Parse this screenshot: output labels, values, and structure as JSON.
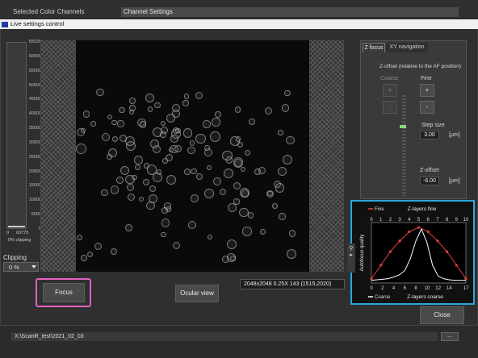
{
  "background_app": {
    "left_label": "Selected Color Channels",
    "channel_settings_label": "Channel Settings",
    "path_value": "X:\\ScanR_test\\2021_02_03",
    "path_button": "..."
  },
  "window": {
    "title": "Live settings control"
  },
  "histogram": {
    "scale_ticks": [
      "65535",
      "60000",
      "55000",
      "50000",
      "45000",
      "40000",
      "35000",
      "30000",
      "25000",
      "20000",
      "15000",
      "10000",
      "5000",
      "0"
    ],
    "range_min": "0",
    "range_max": "63775",
    "clipping_pct_text": "0% clipping",
    "clipping_label": "Clipping",
    "clipping_value": "0 %"
  },
  "image_info": "2048x2048 0.25X 143   (1515,2020)",
  "buttons": {
    "focus": "Focus",
    "ocular_view": "Ocular view",
    "close": "Close"
  },
  "tabs": [
    {
      "label": "Z focus",
      "active": true
    },
    {
      "label": "XY navigation",
      "active": false
    }
  ],
  "z_focus": {
    "z_offset_caption": "Z-offset (relative to the AF position)",
    "coarse_label": "Coarse",
    "fine_label": "Fine",
    "plus": "+",
    "minus": "-",
    "step_size_label": "Step size",
    "step_size_value": "3.00",
    "step_unit": "[µm]",
    "z_offset_label": "Z-offset",
    "z_offset_value": "-6.00",
    "z_offset_unit": "[µm]"
  },
  "chart_data": {
    "type": "line",
    "title_top": "Z-layers fine",
    "xlabel_bottom": "Z-layers coarse",
    "ylabel": "Autofocus quality",
    "legend_fine": "Fine",
    "legend_coarse": "Coarse",
    "fine_ticks": [
      "0",
      "1",
      "2",
      "3",
      "4",
      "5",
      "6",
      "7",
      "8",
      "9",
      "10"
    ],
    "coarse_ticks": [
      "0",
      "2",
      "4",
      "6",
      "8",
      "10",
      "12",
      "14",
      "17"
    ],
    "colors": {
      "fine": "#e04040",
      "coarse": "#ffffff",
      "frame": "#29a8dc"
    },
    "series": [
      {
        "name": "Fine",
        "axis": "fine",
        "x": [
          0,
          1,
          2,
          3,
          4,
          5,
          6,
          7,
          8,
          9,
          10
        ],
        "y": [
          0.05,
          0.3,
          0.55,
          0.75,
          0.92,
          1.0,
          0.92,
          0.75,
          0.55,
          0.3,
          0.05
        ]
      },
      {
        "name": "Coarse",
        "axis": "coarse",
        "x": [
          0,
          1,
          2,
          3,
          4,
          5,
          6,
          7,
          8,
          9,
          10,
          11,
          12,
          13,
          14,
          15,
          16,
          17
        ],
        "y": [
          0.02,
          0.03,
          0.04,
          0.05,
          0.08,
          0.12,
          0.2,
          0.42,
          0.75,
          0.97,
          0.72,
          0.3,
          0.1,
          0.05,
          0.03,
          0.02,
          0.02,
          0.02
        ]
      }
    ],
    "ylim": [
      0,
      1
    ]
  }
}
